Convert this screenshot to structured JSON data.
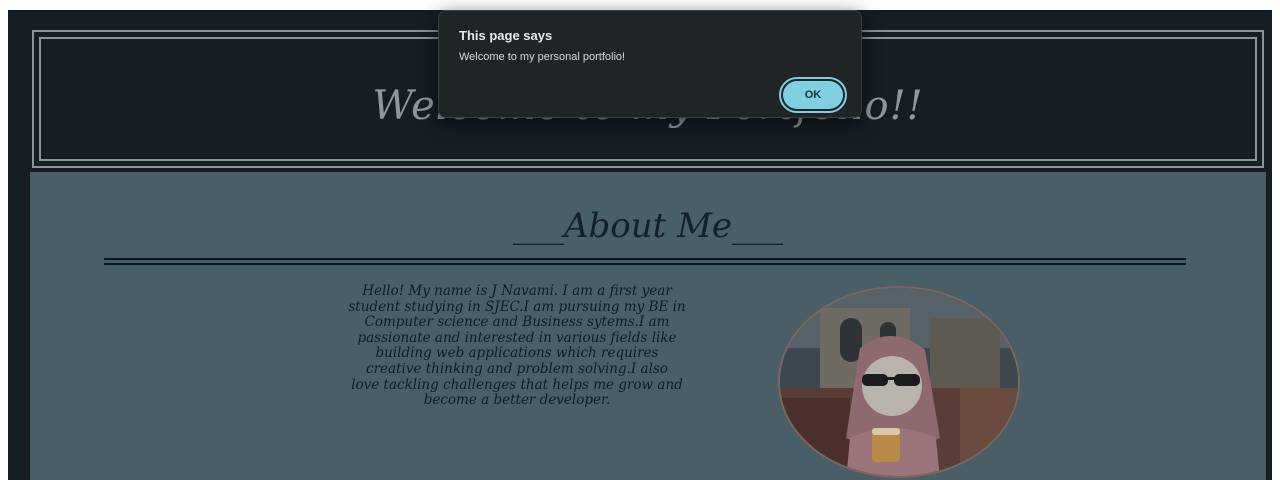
{
  "header": {
    "title": "Welcome to my Portfolio!!"
  },
  "about": {
    "title": "___About Me___",
    "bio_lines": [
      "Hello! My name is J Navami. I am a first year",
      "student studying in SJEC.I am pursuing my BE in",
      "Computer science and Business sytems.I am",
      "passionate and interested in various fields like",
      "building web applications which requires",
      "creative thinking and problem solving.I also",
      "love tackling challenges that helps me grow and",
      "become a better developer."
    ]
  },
  "dialog": {
    "title": "This page says",
    "message": "Welcome to my personal portfolio!",
    "ok_label": "OK"
  },
  "colors": {
    "page_bg": "#151d25",
    "main_bg": "#4a5e68",
    "accent": "#7ed0e2"
  }
}
